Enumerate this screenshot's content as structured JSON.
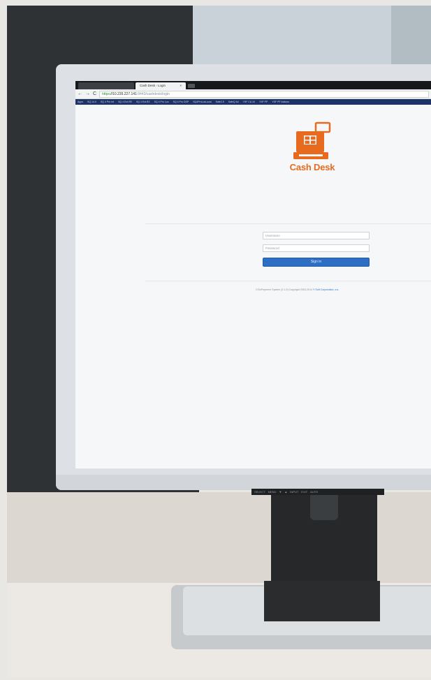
{
  "browser": {
    "tabs": [
      {
        "label": "",
        "active": false
      },
      {
        "label": "Cash Desk - Login",
        "active": true
      }
    ],
    "tab_close": "×",
    "nav": {
      "back": "←",
      "forward": "→",
      "reload": "C"
    },
    "url": {
      "protocol": "https",
      "host": "10.235.227.141",
      "path": ":8443/cashdesk/login"
    },
    "bookmarks": [
      "Apps",
      "SQ 14.0",
      "SQ 4 Pro Int",
      "SQ 4 Ext.RE",
      "SQ 4 Ext.RZ",
      "SQ 4 Pro Loc",
      "SQ 4 Pro DSP",
      "SQ4ProLocLocal",
      "Safe2.5",
      "SafeQ 6d",
      "YSF CA 10",
      "YSF PP",
      "YSF PP Actions"
    ]
  },
  "login": {
    "brand": "Cash Desk",
    "username_placeholder": "Username",
    "password_placeholder": "Password",
    "signin_label": "Sign in",
    "footer_text": "CS/ePayment System (2.1.0) Copyright 2003-2014 ",
    "footer_link": "Y Soft Corporation, a.s."
  },
  "monitor": {
    "osd_labels": [
      "SELECT",
      "MENU",
      "▼",
      "▲",
      "INPUT",
      "EXIT",
      "AUTO"
    ]
  },
  "colors": {
    "brand_orange": "#e86a1f",
    "button_blue": "#2c6fc4"
  }
}
